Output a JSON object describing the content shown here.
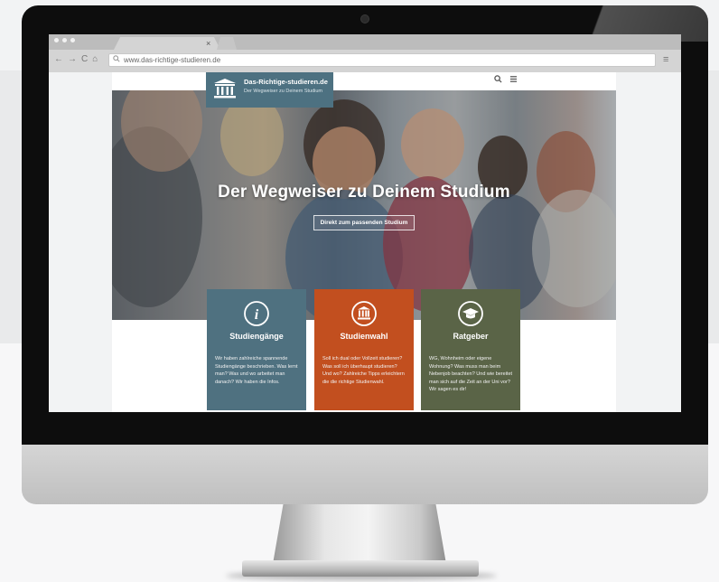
{
  "colors": {
    "logo_bg": "#4d7181",
    "card1_bg": "#4f7180",
    "card2_bg": "#c24f1f",
    "card3_bg": "#5a6447"
  },
  "browser": {
    "nav_back": "←",
    "nav_forward": "→",
    "nav_reload": "C",
    "nav_home": "⌂",
    "tab_close": "×",
    "url": "www.das-richtige-studieren.de",
    "url_search_icon": "search-icon",
    "menu_icon": "hamburger-icon"
  },
  "site": {
    "logo_title": "Das-Richtige-studieren.de",
    "logo_subtitle": "Der Wegweiser zu Deinem Studium",
    "header_icons": [
      "search-icon",
      "menu-icon"
    ],
    "hero_title": "Der Wegweiser zu Deinem Studium",
    "hero_button": "Direkt zum passenden Studium",
    "cards": [
      {
        "icon": "info-icon",
        "title": "Studiengänge",
        "text": "Wir haben zahlreiche spannende Studiengänge beschrieben. Was lernt man? Was und wo arbeitet man danach? Wir haben die Infos."
      },
      {
        "icon": "university-icon",
        "title": "Studienwahl",
        "text": "Soll ich dual oder Vollzeit studieren? Was soll ich überhaupt studieren? Und wo? Zahlreiche Tipps erleichtern die die richtige Studienwahl."
      },
      {
        "icon": "graduation-cap-icon",
        "title": "Ratgeber",
        "text": "WG, Wohnheim oder eigene Wohnung? Was muss man beim Nebenjob beachten? Und wie bereitet man sich auf die Zeit an der Uni vor? Wir sagen es dir!"
      }
    ]
  }
}
